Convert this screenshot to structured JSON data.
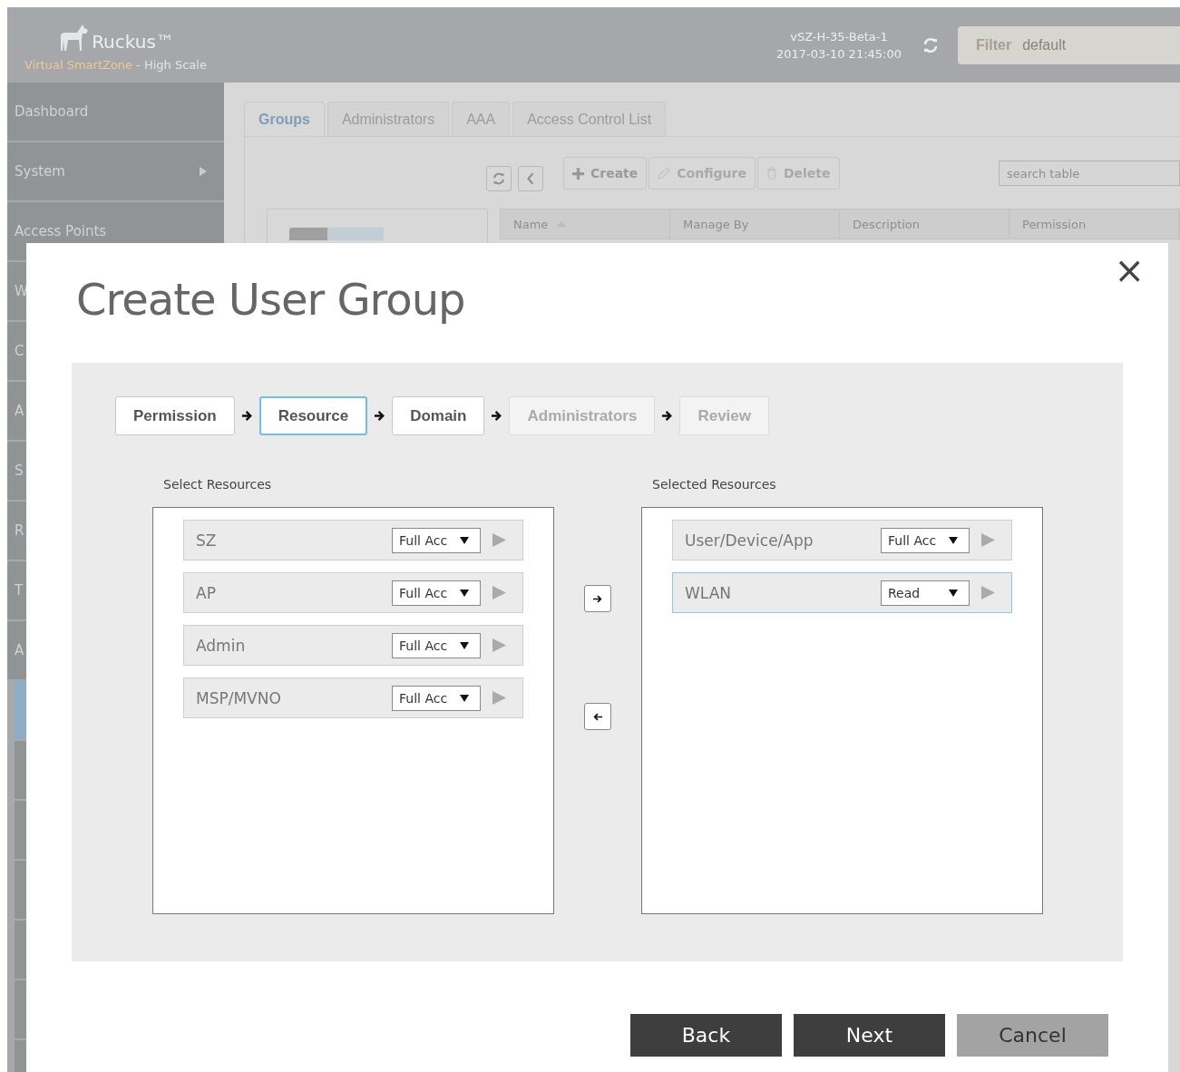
{
  "header": {
    "brand": "Ruckus™",
    "product": "Virtual SmartZone",
    "edition": "- High Scale",
    "host": "vSZ-H-35-Beta-1",
    "datetime": "2017-03-10  21:45:00",
    "filter": {
      "label": "Filter",
      "value": "default"
    }
  },
  "sidebar": {
    "items": [
      {
        "label": "Dashboard",
        "has_submenu": false
      },
      {
        "label": "System",
        "has_submenu": true
      },
      {
        "label": "Access Points",
        "has_submenu": false
      },
      {
        "label": "W"
      },
      {
        "label": "C"
      },
      {
        "label": "A"
      },
      {
        "label": "S"
      },
      {
        "label": "R"
      },
      {
        "label": "T"
      },
      {
        "label": "A"
      }
    ],
    "subitems": [
      {
        "selected": true
      },
      {
        "selected": false
      },
      {
        "selected": false
      },
      {
        "selected": false
      },
      {
        "selected": false
      },
      {
        "selected": false
      },
      {
        "selected": false
      }
    ]
  },
  "tabs": [
    {
      "label": "Groups",
      "selected": true
    },
    {
      "label": "Administrators",
      "selected": false
    },
    {
      "label": "AAA",
      "selected": false
    },
    {
      "label": "Access Control List",
      "selected": false
    }
  ],
  "toolbar": {
    "actions": [
      {
        "label": "Create",
        "kind": "create",
        "disabled": false
      },
      {
        "label": "Configure",
        "kind": "configure",
        "disabled": true
      },
      {
        "label": "Delete",
        "kind": "delete",
        "disabled": true
      }
    ],
    "search": {
      "placeholder": "search table"
    }
  },
  "table": {
    "columns": [
      "Name",
      "Manage By",
      "Description",
      "Permission"
    ]
  },
  "dialog": {
    "title": "Create User Group",
    "close": "×",
    "steps": [
      {
        "label": "Permission",
        "selected": false,
        "disabled": false
      },
      {
        "label": "Resource",
        "selected": true,
        "disabled": false
      },
      {
        "label": "Domain",
        "selected": false,
        "disabled": false
      },
      {
        "label": "Administrators",
        "selected": false,
        "disabled": true
      },
      {
        "label": "Review",
        "selected": false,
        "disabled": true
      }
    ],
    "available": {
      "label": "Select Resources",
      "items": [
        {
          "name": "SZ",
          "access": "Full Acc",
          "selected": false
        },
        {
          "name": "AP",
          "access": "Full Acc",
          "selected": false
        },
        {
          "name": "Admin",
          "access": "Full Acc",
          "selected": false
        },
        {
          "name": "MSP/MVNO",
          "access": "Full Acc",
          "selected": false
        }
      ]
    },
    "chosen": {
      "label": "Selected Resources",
      "items": [
        {
          "name": "User/Device/App",
          "access": "Full Acc",
          "selected": false
        },
        {
          "name": "WLAN",
          "access": "Read",
          "selected": true
        }
      ]
    },
    "buttons": [
      {
        "label": "Back",
        "kind": "dark"
      },
      {
        "label": "Next",
        "kind": "dark"
      },
      {
        "label": "Cancel",
        "kind": "muted"
      }
    ]
  }
}
